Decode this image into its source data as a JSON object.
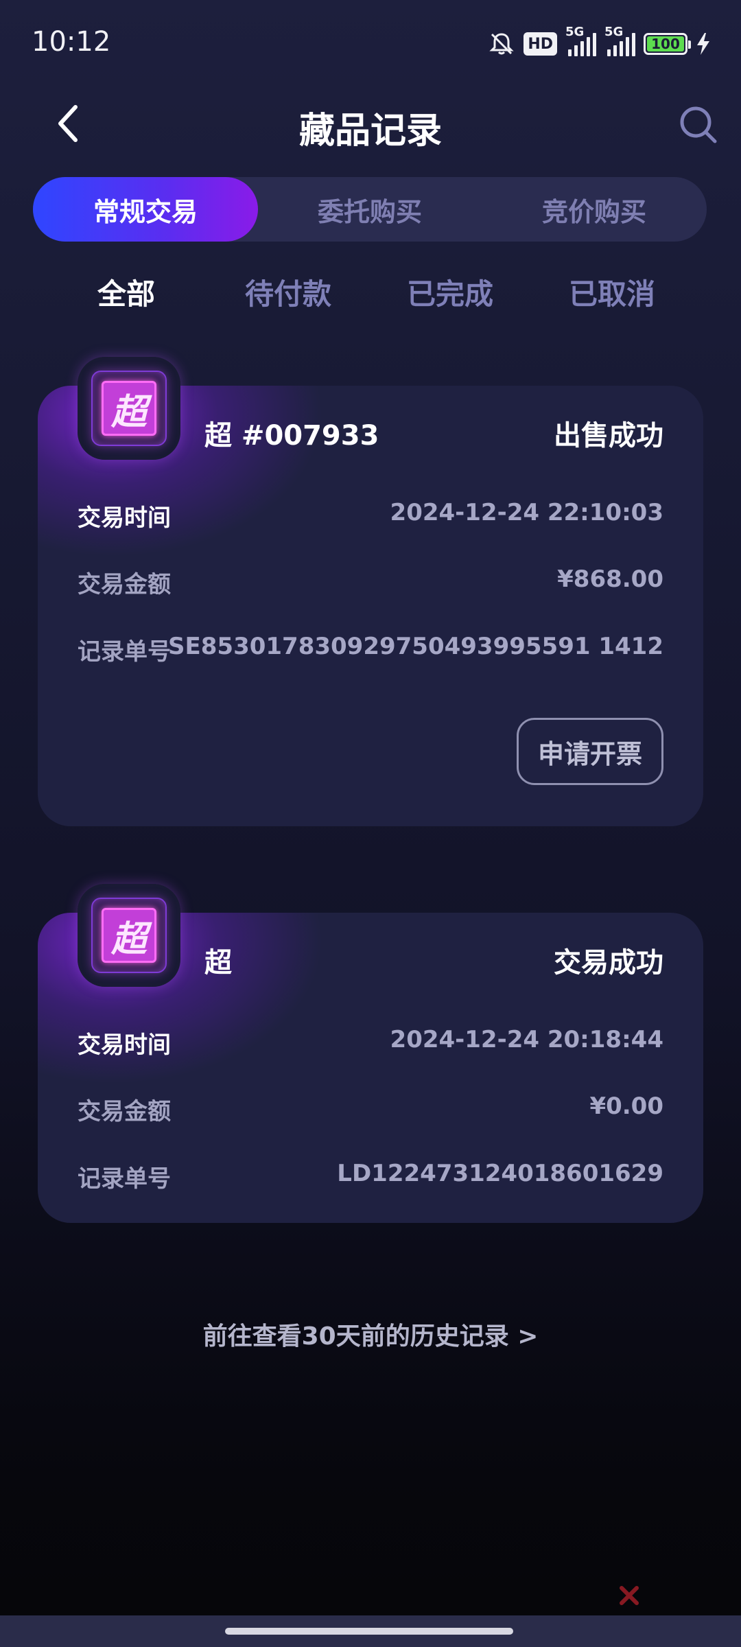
{
  "status_bar": {
    "time": "10:12",
    "hd_label": "HD",
    "signal1_label": "5G",
    "signal2_label": "5G",
    "battery": "100"
  },
  "header": {
    "title": "藏品记录"
  },
  "segments": [
    {
      "label": "常规交易",
      "active": true
    },
    {
      "label": "委托购买",
      "active": false
    },
    {
      "label": "竞价购买",
      "active": false
    }
  ],
  "filters": [
    {
      "label": "全部",
      "active": true
    },
    {
      "label": "待付款",
      "active": false
    },
    {
      "label": "已完成",
      "active": false
    },
    {
      "label": "已取消",
      "active": false
    }
  ],
  "records": [
    {
      "thumb_glyph": "超",
      "name": "超 #007933",
      "status": "出售成功",
      "time_label": "交易时间",
      "time_value": "2024-12-24 22:10:03",
      "amount_label": "交易金额",
      "amount_value": "¥868.00",
      "order_label": "记录单号",
      "order_value": "SE853017830929750493995591 1412",
      "invoice_label": "申请开票"
    },
    {
      "thumb_glyph": "超",
      "name": "超",
      "status": "交易成功",
      "time_label": "交易时间",
      "time_value": "2024-12-24 20:18:44",
      "amount_label": "交易金额",
      "amount_value": "¥0.00",
      "order_label": "记录单号",
      "order_value": "LD122473124018601629"
    }
  ],
  "history_link": "前往查看30天前的历史记录 >",
  "colors": {
    "accent_start": "#2f46ff",
    "accent_end": "#8a1be8",
    "background": "#181a34",
    "card": "#1f2141"
  }
}
